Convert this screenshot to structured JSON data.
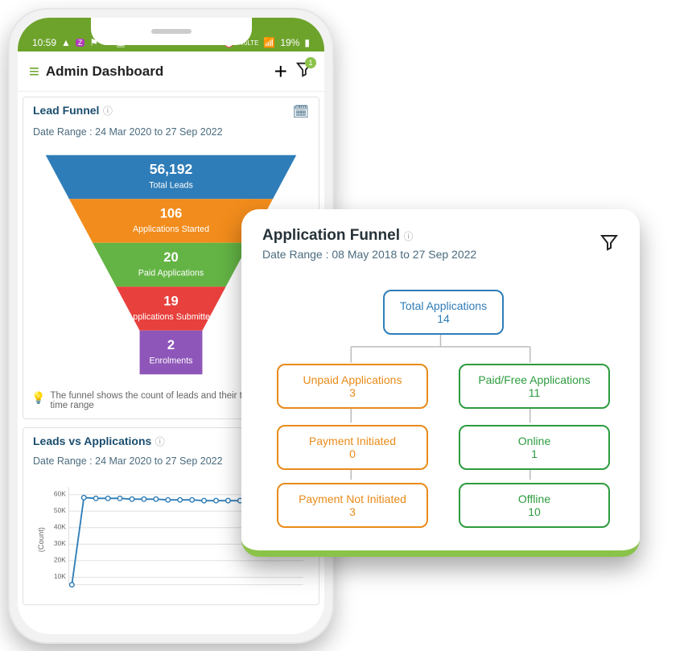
{
  "statusbar": {
    "time": "10:59",
    "battery": "19%"
  },
  "appbar": {
    "title": "Admin Dashboard",
    "filter_badge": "1"
  },
  "lead_funnel": {
    "title": "Lead Funnel",
    "date_range": "Date Range : 24 Mar 2020 to 27 Sep 2022",
    "steps": [
      {
        "value": "56,192",
        "label": "Total Leads"
      },
      {
        "value": "106",
        "label": "Applications Started"
      },
      {
        "value": "20",
        "label": "Paid Applications"
      },
      {
        "value": "19",
        "label": "Applications Submitted"
      },
      {
        "value": "2",
        "label": "Enrolments"
      }
    ],
    "tip": "The funnel shows the count of leads and their the specified time range"
  },
  "leads_vs_apps": {
    "title": "Leads vs Applications",
    "date_range": "Date Range : 24 Mar 2020 to 27 Sep 2022",
    "ylabel": "(Count)"
  },
  "chart_data": {
    "type": "line",
    "ylabel": "(Count)",
    "ylim": [
      0,
      60000
    ],
    "yticks": [
      "10K",
      "20K",
      "30K",
      "40K",
      "50K",
      "60K"
    ],
    "x": [
      0,
      1,
      2,
      3,
      4,
      5,
      6,
      7,
      8,
      9,
      10,
      11,
      12,
      13,
      14,
      15,
      16,
      17,
      18,
      19
    ],
    "values": [
      0,
      56000,
      55800,
      55800,
      55800,
      55700,
      55600,
      55600,
      55500,
      55500,
      55400,
      55400,
      55300,
      55300,
      55200,
      55200,
      55100,
      55100,
      55000,
      55000
    ]
  },
  "app_funnel": {
    "title": "Application Funnel",
    "date_range": "Date Range : 08 May 2018 to 27 Sep 2022",
    "root": {
      "name": "Total Applications",
      "value": "14"
    },
    "left": {
      "name": "Unpaid Applications",
      "value": "3",
      "children": [
        {
          "name": "Payment Initiated",
          "value": "0"
        },
        {
          "name": "Payment Not Initiated",
          "value": "3"
        }
      ]
    },
    "right": {
      "name": "Paid/Free Applications",
      "value": "11",
      "children": [
        {
          "name": "Online",
          "value": "1"
        },
        {
          "name": "Offline",
          "value": "10"
        }
      ]
    }
  },
  "colors": {
    "funnel": [
      "#2f7db8",
      "#f28c1c",
      "#64b445",
      "#e8403d",
      "#8e56b9"
    ]
  }
}
